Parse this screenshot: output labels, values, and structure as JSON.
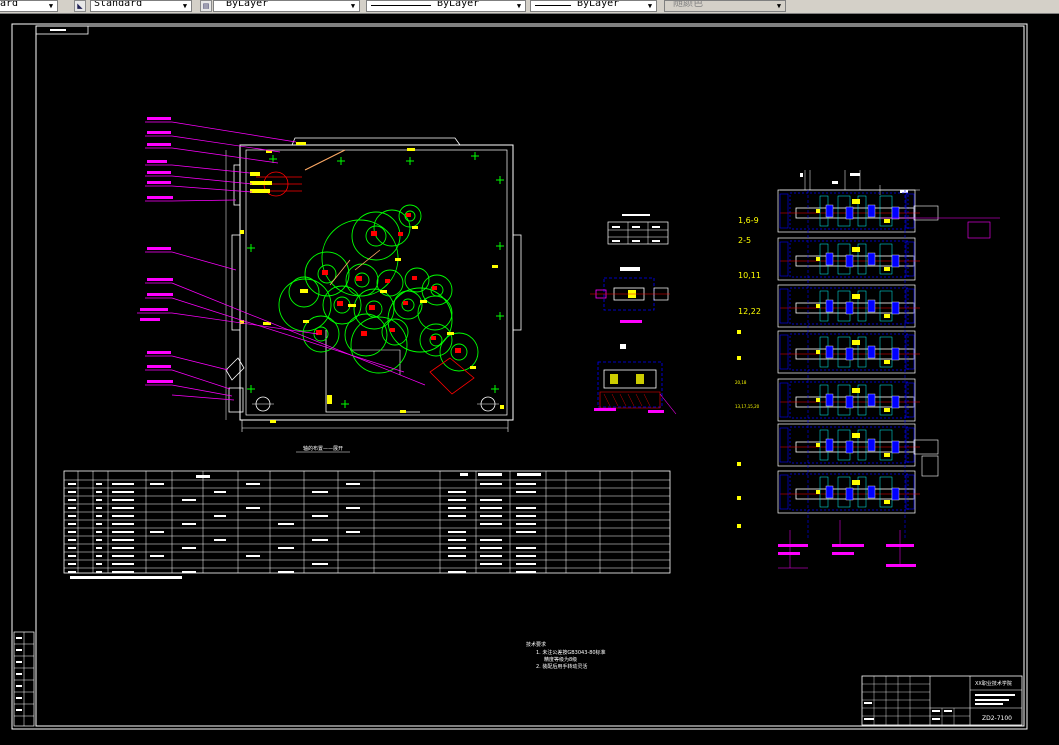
{
  "toolbar": {
    "text_style_fragment": "ard",
    "dim_style": "Standard",
    "layer_box": "ByLayer",
    "linetype": "ByLayer",
    "lineweight": "ByLayer",
    "plot_style": "随颜色"
  },
  "drawing": {
    "view_plate_label_1": "1,6-9",
    "view_plate_label_2": "2-5",
    "view_plate_label_3": "10,11",
    "view_plate_label_4": "12,22",
    "view_plate_label_5": "20,18",
    "view_plate_label_6": "13,17,15,20",
    "note_title": "技术要求",
    "note_line_1": "1. 未注公差按GB3043-80标准",
    "note_line_1b": "精度等级为8级",
    "note_line_2": "2. 装配后用手转动灵活",
    "title_block_name": "XX职业技术学院",
    "drawing_number": "ZD2-7100",
    "table_caption": "轴的布置——展开"
  },
  "colors": {
    "background": "#000000",
    "frame": "#ffffff",
    "magenta": "#ff00ff",
    "green": "#00ff00",
    "red": "#ff0000",
    "yellow": "#ffff00",
    "blue": "#0000ff",
    "cyan": "#00ffff"
  },
  "icons": [
    "dimstyle-icon",
    "layer-icon",
    "linetype-icon",
    "lineweight-icon"
  ]
}
